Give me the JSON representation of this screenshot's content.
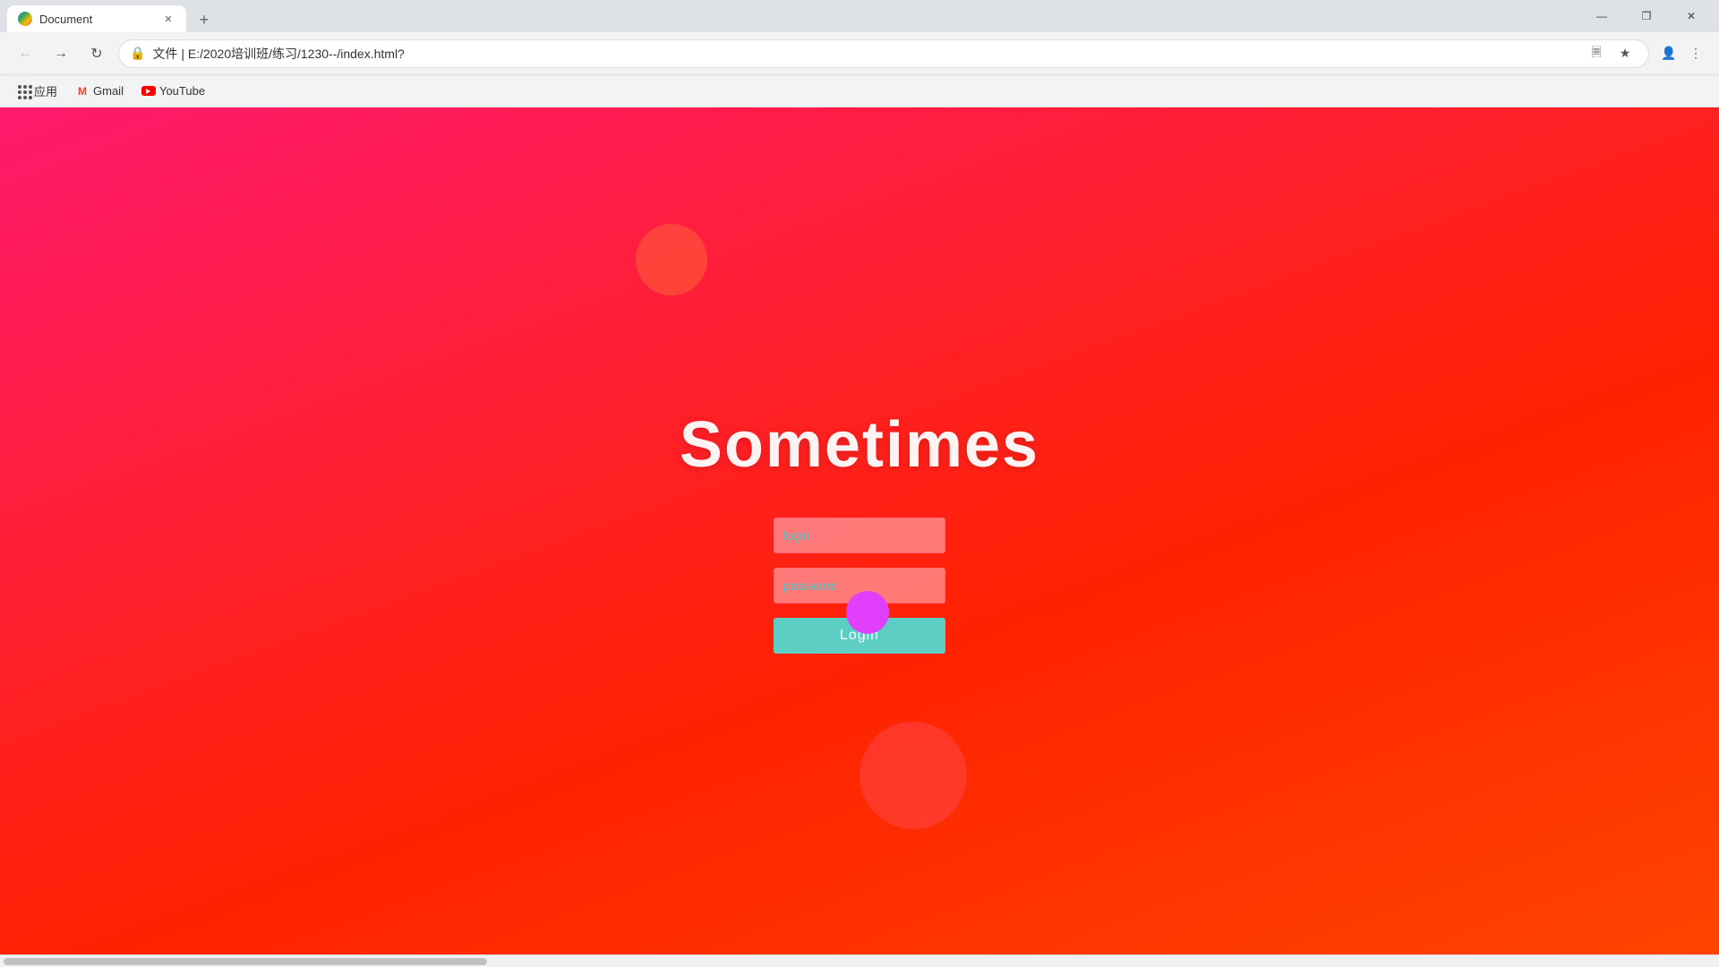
{
  "browser": {
    "tab": {
      "title": "Document",
      "favicon": "document-icon"
    },
    "new_tab_label": "+",
    "window_controls": {
      "minimize": "—",
      "maximize": "❐",
      "close": "✕"
    },
    "nav": {
      "back_title": "Back",
      "forward_title": "Forward",
      "refresh_title": "Refresh",
      "address": "E:/2020培训班/练习/1230--/index.html?",
      "address_label": "文件 | E:/2020培训班/练习/1230--/index.html?"
    },
    "bookmarks": {
      "apps_label": "应用",
      "gmail_label": "Gmail",
      "youtube_label": "YouTube"
    }
  },
  "page": {
    "heading": "Sometimes",
    "login_placeholder": "login",
    "password_placeholder": "password",
    "login_button_label": "Login"
  }
}
